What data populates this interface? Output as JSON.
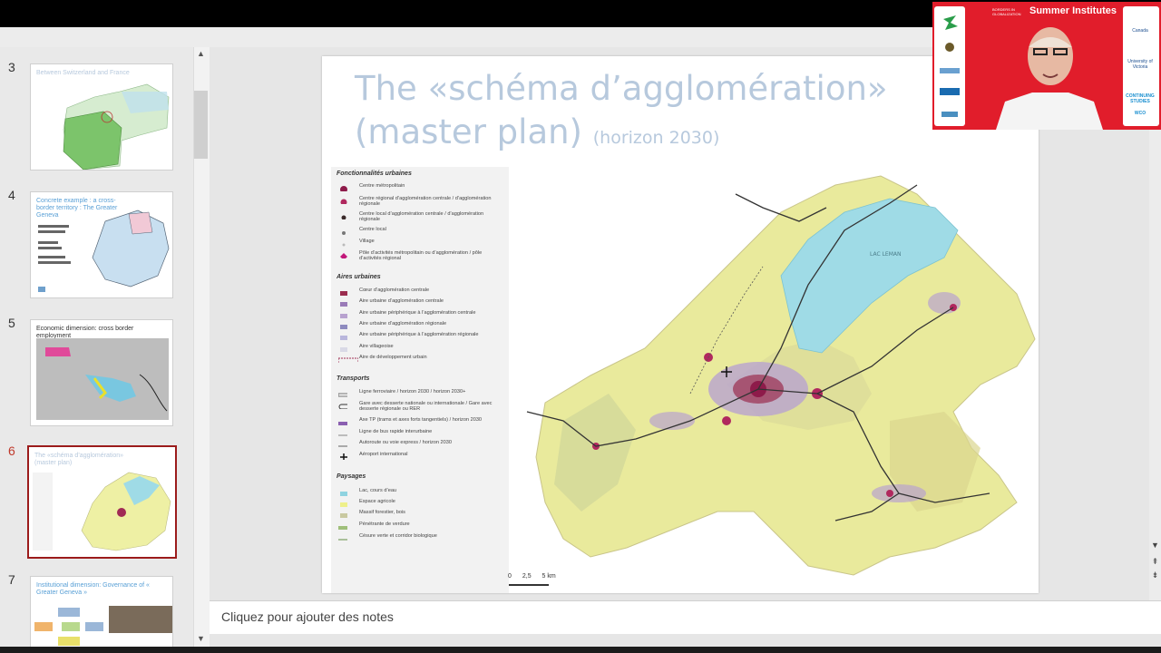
{
  "thumbnails": [
    {
      "num": "3",
      "title": "Between Switzerland and France",
      "active": false
    },
    {
      "num": "4",
      "title": "Concrete example : a cross-border territory : The Greater Geneva",
      "active": false
    },
    {
      "num": "5",
      "title": "Economic dimension: cross border employment",
      "active": false
    },
    {
      "num": "6",
      "title": "The «schéma d’agglomération» (master plan)",
      "active": true
    },
    {
      "num": "7",
      "title": "Institutional dimension: Governance of « Greater Geneva »",
      "active": false
    }
  ],
  "slide": {
    "title_line1": "The «schéma d’agglomération»",
    "title_line2": "(master plan)",
    "subtitle": "(horizon 2030)",
    "map_labels": {
      "lake": "LAC LEMAN"
    },
    "legend": {
      "sections": [
        {
          "heading": "Fonctionnalités urbaines",
          "items": [
            {
              "label": "Centre métropolitain",
              "color": "#8e1b4a"
            },
            {
              "label": "Centre régional d’agglomération centrale / d’agglomération régionale",
              "color": "#b0285e"
            },
            {
              "label": "Centre local d’agglomération centrale / d’agglomération régionale",
              "color": "#3a2a2a"
            },
            {
              "label": "Centre local",
              "color": "#777777"
            },
            {
              "label": "Village",
              "color": "#bbbbbb"
            },
            {
              "label": "Pôle d’activités métropolitain ou d’agglomération / pôle d’activités régional",
              "color": "#c2187a"
            }
          ]
        },
        {
          "heading": "Aires urbaines",
          "items": [
            {
              "label": "Cœur d’agglomération centrale",
              "color": "#9b2d4f"
            },
            {
              "label": "Aire urbaine d’agglomération centrale",
              "color": "#9a7bb8"
            },
            {
              "label": "Aire urbaine périphérique à l’agglomération centrale",
              "color": "#b8a2cf"
            },
            {
              "label": "Aire urbaine d’agglomération régionale",
              "color": "#8e8bbf"
            },
            {
              "label": "Aire urbaine périphérique à l’agglomération régionale",
              "color": "#b9b6dc"
            },
            {
              "label": "Aire villageoise",
              "color": "#d9d9e6"
            },
            {
              "label": "Aire de développement urbain",
              "color": "#a13355"
            }
          ]
        },
        {
          "heading": "Transports",
          "items": [
            {
              "label": "Ligne ferroviaire / horizon 2030 / horizon 2030+",
              "color": "#555555"
            },
            {
              "label": "Gare avec desserte nationale ou internationale / Gare avec desserte régionale ou RER",
              "color": "#333333"
            },
            {
              "label": "Axe TP (trams et axes forts tangentiels) / horizon 2030",
              "color": "#8a5fb0"
            },
            {
              "label": "Ligne de bus rapide interurbaine",
              "color": "#999999"
            },
            {
              "label": "Autoroute ou voie express / horizon 2030",
              "color": "#aaaaaa"
            },
            {
              "label": "Aéroport international",
              "color": "#111111"
            }
          ]
        },
        {
          "heading": "Paysages",
          "items": [
            {
              "label": "Lac, cours d’eau",
              "color": "#8fd3e0"
            },
            {
              "label": "Espace agricole",
              "color": "#eef08a"
            },
            {
              "label": "Massif forestier, bois",
              "color": "#c9c9a0"
            },
            {
              "label": "Pénétrante de verdure",
              "color": "#9fbf7a"
            },
            {
              "label": "Césure verte et corridor biologique",
              "color": "#7aa060"
            }
          ]
        }
      ]
    },
    "scale": {
      "labels": [
        "0",
        "2,5",
        "5 km"
      ]
    }
  },
  "notes": {
    "placeholder": "Cliquez pour ajouter des notes"
  },
  "video": {
    "title": "Summer Institutes",
    "org_small": "BORDERS IN GLOBALIZATION",
    "right_logos": [
      "Canada",
      "University of Victoria",
      "CONTINUING STUDIES",
      "WCO"
    ]
  },
  "colors": {
    "accent_red": "#e11d2b",
    "active_thumb_border": "#9b1b1b",
    "title_blue": "#b7c9dd"
  }
}
